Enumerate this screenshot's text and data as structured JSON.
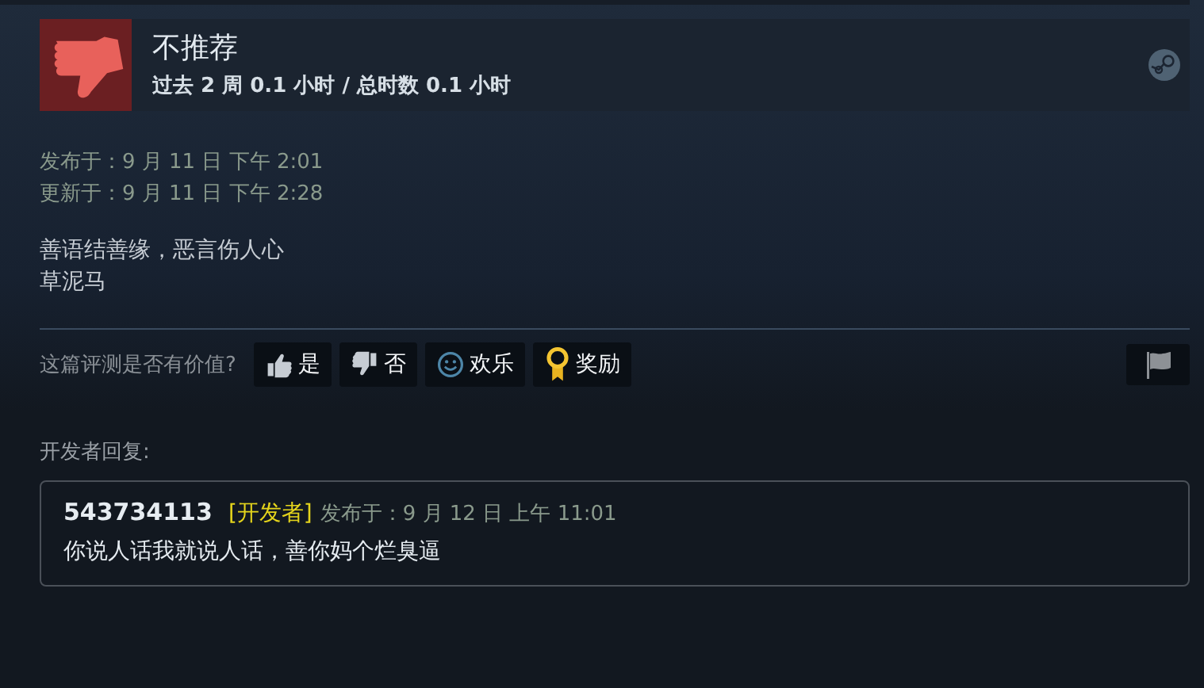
{
  "review": {
    "recommended": false,
    "verdict": "不推荐",
    "hours": "过去 2 周 0.1 小时 / 总时数 0.1 小时"
  },
  "dates": [
    "发布于：9 月 11 日 下午 2:01",
    "更新于：9 月 11 日 下午 2:28"
  ],
  "body": [
    "善语结善缘，恶言伤人心",
    "草泥马"
  ],
  "helpful": {
    "prompt": "这篇评测是否有价值?",
    "buttons": [
      {
        "kind": "yes",
        "label": "是"
      },
      {
        "kind": "no",
        "label": "否"
      },
      {
        "kind": "funny",
        "label": "欢乐"
      },
      {
        "kind": "award",
        "label": "奖励"
      }
    ]
  },
  "developer_response": {
    "heading": "开发者回复:",
    "author": "543734113",
    "tag": "[开发者]",
    "posted": "发布于：9 月 12 日 上午 11:01",
    "text": "你说人话我就说人话，善你妈个烂臭逼"
  }
}
